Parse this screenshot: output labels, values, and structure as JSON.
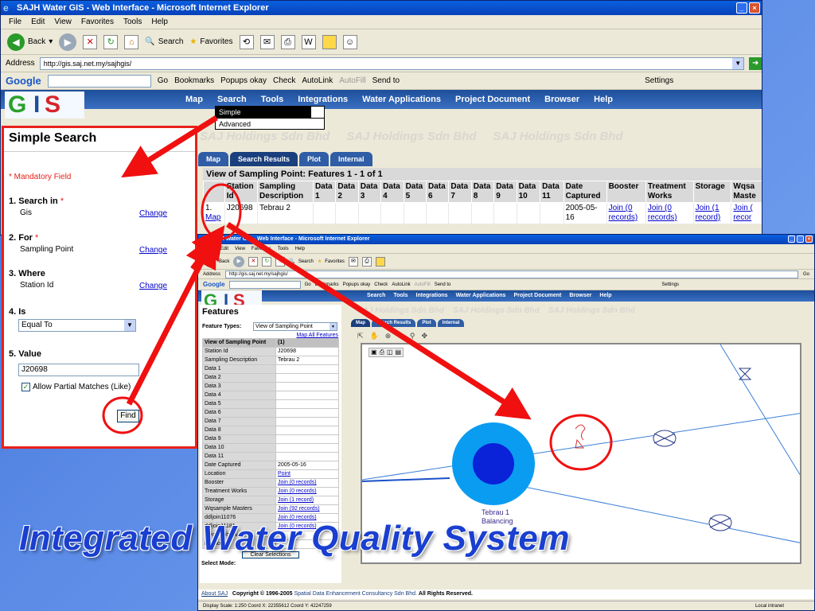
{
  "win1": {
    "title": "SAJH Water GIS - Web Interface - Microsoft Internet Explorer",
    "menu": [
      "File",
      "Edit",
      "View",
      "Favorites",
      "Tools",
      "Help"
    ],
    "toolbar": {
      "back": "Back",
      "search": "Search",
      "favorites": "Favorites"
    },
    "address_label": "Address",
    "address_url": "http://gis.saj.net.my/sajhgis/",
    "google": {
      "logo": "Google",
      "go": "Go",
      "bookmarks": "Bookmarks",
      "popups": "Popups okay",
      "check": "Check",
      "autolink": "AutoLink",
      "autofill": "AutoFill",
      "sendto": "Send to",
      "settings": "Settings"
    },
    "app_menu": [
      "Map",
      "Search",
      "Tools",
      "Integrations",
      "Water Applications",
      "Project Document",
      "Browser",
      "Help"
    ],
    "dropdown": [
      "Simple",
      "Advanced"
    ],
    "tabs": [
      "Map",
      "Search Results",
      "Plot",
      "Internal"
    ],
    "watermark": "SAJ Holdings Sdn Bhd",
    "results_caption": "View of Sampling Point: Features 1 - 1 of 1",
    "columns": [
      "",
      "Station Id",
      "Sampling Description",
      "Data 1",
      "Data 2",
      "Data 3",
      "Data 4",
      "Data 5",
      "Data 6",
      "Data 7",
      "Data 8",
      "Data 9",
      "Data 10",
      "Data 11",
      "Date Captured",
      "Booster",
      "Treatment Works",
      "Storage",
      "Wqsa Maste"
    ],
    "row": {
      "num": "1.",
      "map": "Map",
      "station": "J20698",
      "desc": "Tebrau 2",
      "date": "2005-05-16",
      "booster": "Join (0 records)",
      "treatment": "Join (0 records)",
      "storage": "Join (1 record)",
      "wqsa": "Join ( recor"
    }
  },
  "panel": {
    "title": "Simple Search",
    "mandatory": "* Mandatory Field",
    "search_in_label": "1. Search in",
    "search_in_value": "Gis",
    "for_label": "2. For",
    "for_value": "Sampling Point",
    "where_label": "3. Where",
    "where_value": "Station Id",
    "is_label": "4. Is",
    "is_value": "Equal To",
    "value_label": "5. Value",
    "value_input": "J20698",
    "partial": "Allow Partial Matches (Like)",
    "change": "Change",
    "find": "Find",
    "star": "*"
  },
  "win2": {
    "title": "SAJH Water GIS - Web Interface - Microsoft Internet Explorer",
    "menu": [
      "File",
      "Edit",
      "View",
      "Favorites",
      "Tools",
      "Help"
    ],
    "toolbar": {
      "back": "Back",
      "search": "Search",
      "favorites": "Favorites"
    },
    "address_label": "Address",
    "address_url": "http://gis.saj.net.my/sajhgis/",
    "go": "Go",
    "google": {
      "logo": "Google",
      "go": "Go",
      "bookmarks": "Bookmarks",
      "popups": "Popups okay",
      "check": "Check",
      "autolink": "AutoLink",
      "autofill": "AutoFill",
      "sendto": "Send to",
      "settings": "Settings"
    },
    "app_menu": [
      "Search",
      "Tools",
      "Integrations",
      "Water Applications",
      "Project Document",
      "Browser",
      "Help"
    ],
    "tabs": [
      "Map",
      "Search Results",
      "Plot",
      "Internal"
    ],
    "features_title": "Features",
    "feature_types_label": "Feature Types:",
    "feature_types_value": "View of Sampling Point",
    "map_all": "Map All Features",
    "table_header": "View of Sampling Point",
    "table_header_count": "(1)",
    "rows": [
      [
        "Station Id",
        "J20698"
      ],
      [
        "Sampling Description",
        "Tebrau 2"
      ],
      [
        "Data 1",
        ""
      ],
      [
        "Data 2",
        ""
      ],
      [
        "Data 3",
        ""
      ],
      [
        "Data 4",
        ""
      ],
      [
        "Data 5",
        ""
      ],
      [
        "Data 6",
        ""
      ],
      [
        "Data 7",
        ""
      ],
      [
        "Data 8",
        ""
      ],
      [
        "Data 9",
        ""
      ],
      [
        "Data 10",
        ""
      ],
      [
        "Data 11",
        ""
      ],
      [
        "Date Captured",
        "2005-05-16"
      ],
      [
        "Location",
        "Point"
      ],
      [
        "Booster",
        "Join (0 records)"
      ],
      [
        "Treatment Works",
        "Join (0 records)"
      ],
      [
        "Storage",
        "Join (1 record)"
      ],
      [
        "Wqsample Masters",
        "Join (92 records)"
      ],
      [
        "ddljoin11076",
        "Join (0 records)"
      ],
      [
        "ddljoin11181",
        "Join (0 records)"
      ],
      [
        "Geography work",
        ""
      ],
      [
        "Previous",
        ""
      ]
    ],
    "clear_selections": "Clear Selections",
    "select_mode": "Select Mode:",
    "map_label_1": "Tebrau 1",
    "map_label_2": "Balancing",
    "footer_about": "About SAJ",
    "footer_copyright": "Copyright © 1996-2005",
    "footer_company": "Spatial Data Enhancement Consultancy Sdn Bhd.",
    "footer_rights": "All Rights Reserved.",
    "status": "Display Scale: 1:250  Coord X: 22355612  Coord Y: 42247259",
    "status_zone": "Local intranet"
  },
  "headline": "Integrated Water Quality System",
  "colors": {
    "accent_red": "#e8201a",
    "headline_blue": "#1a3fd0",
    "app_blue": "#1d4f9a",
    "reservoir_outer": "#0a9cf0",
    "reservoir_inner": "#0a22d8"
  }
}
